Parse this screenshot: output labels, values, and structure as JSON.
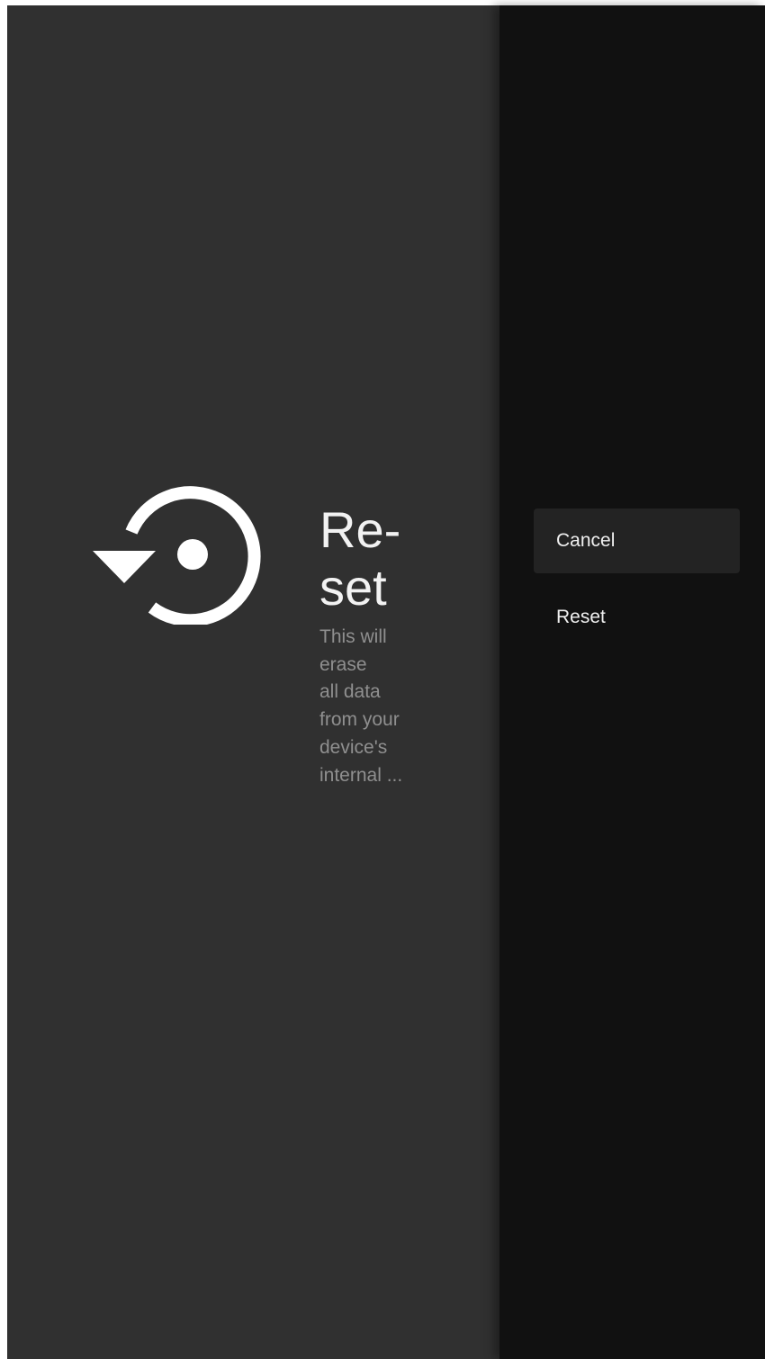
{
  "dialog": {
    "icon": "reset-icon",
    "title": "Re-\nset",
    "description": "This will\nerase\nall data\nfrom your\ndevice's\ninternal ..."
  },
  "actions": [
    {
      "label": "Cancel",
      "focused": true
    },
    {
      "label": "Reset",
      "focused": false
    }
  ],
  "colors": {
    "left_pane_bg": "#303030",
    "right_pane_bg": "#111111",
    "focused_item_bg": "#232323",
    "text_primary": "#f2f2f2",
    "text_secondary": "#8f8f8f"
  }
}
